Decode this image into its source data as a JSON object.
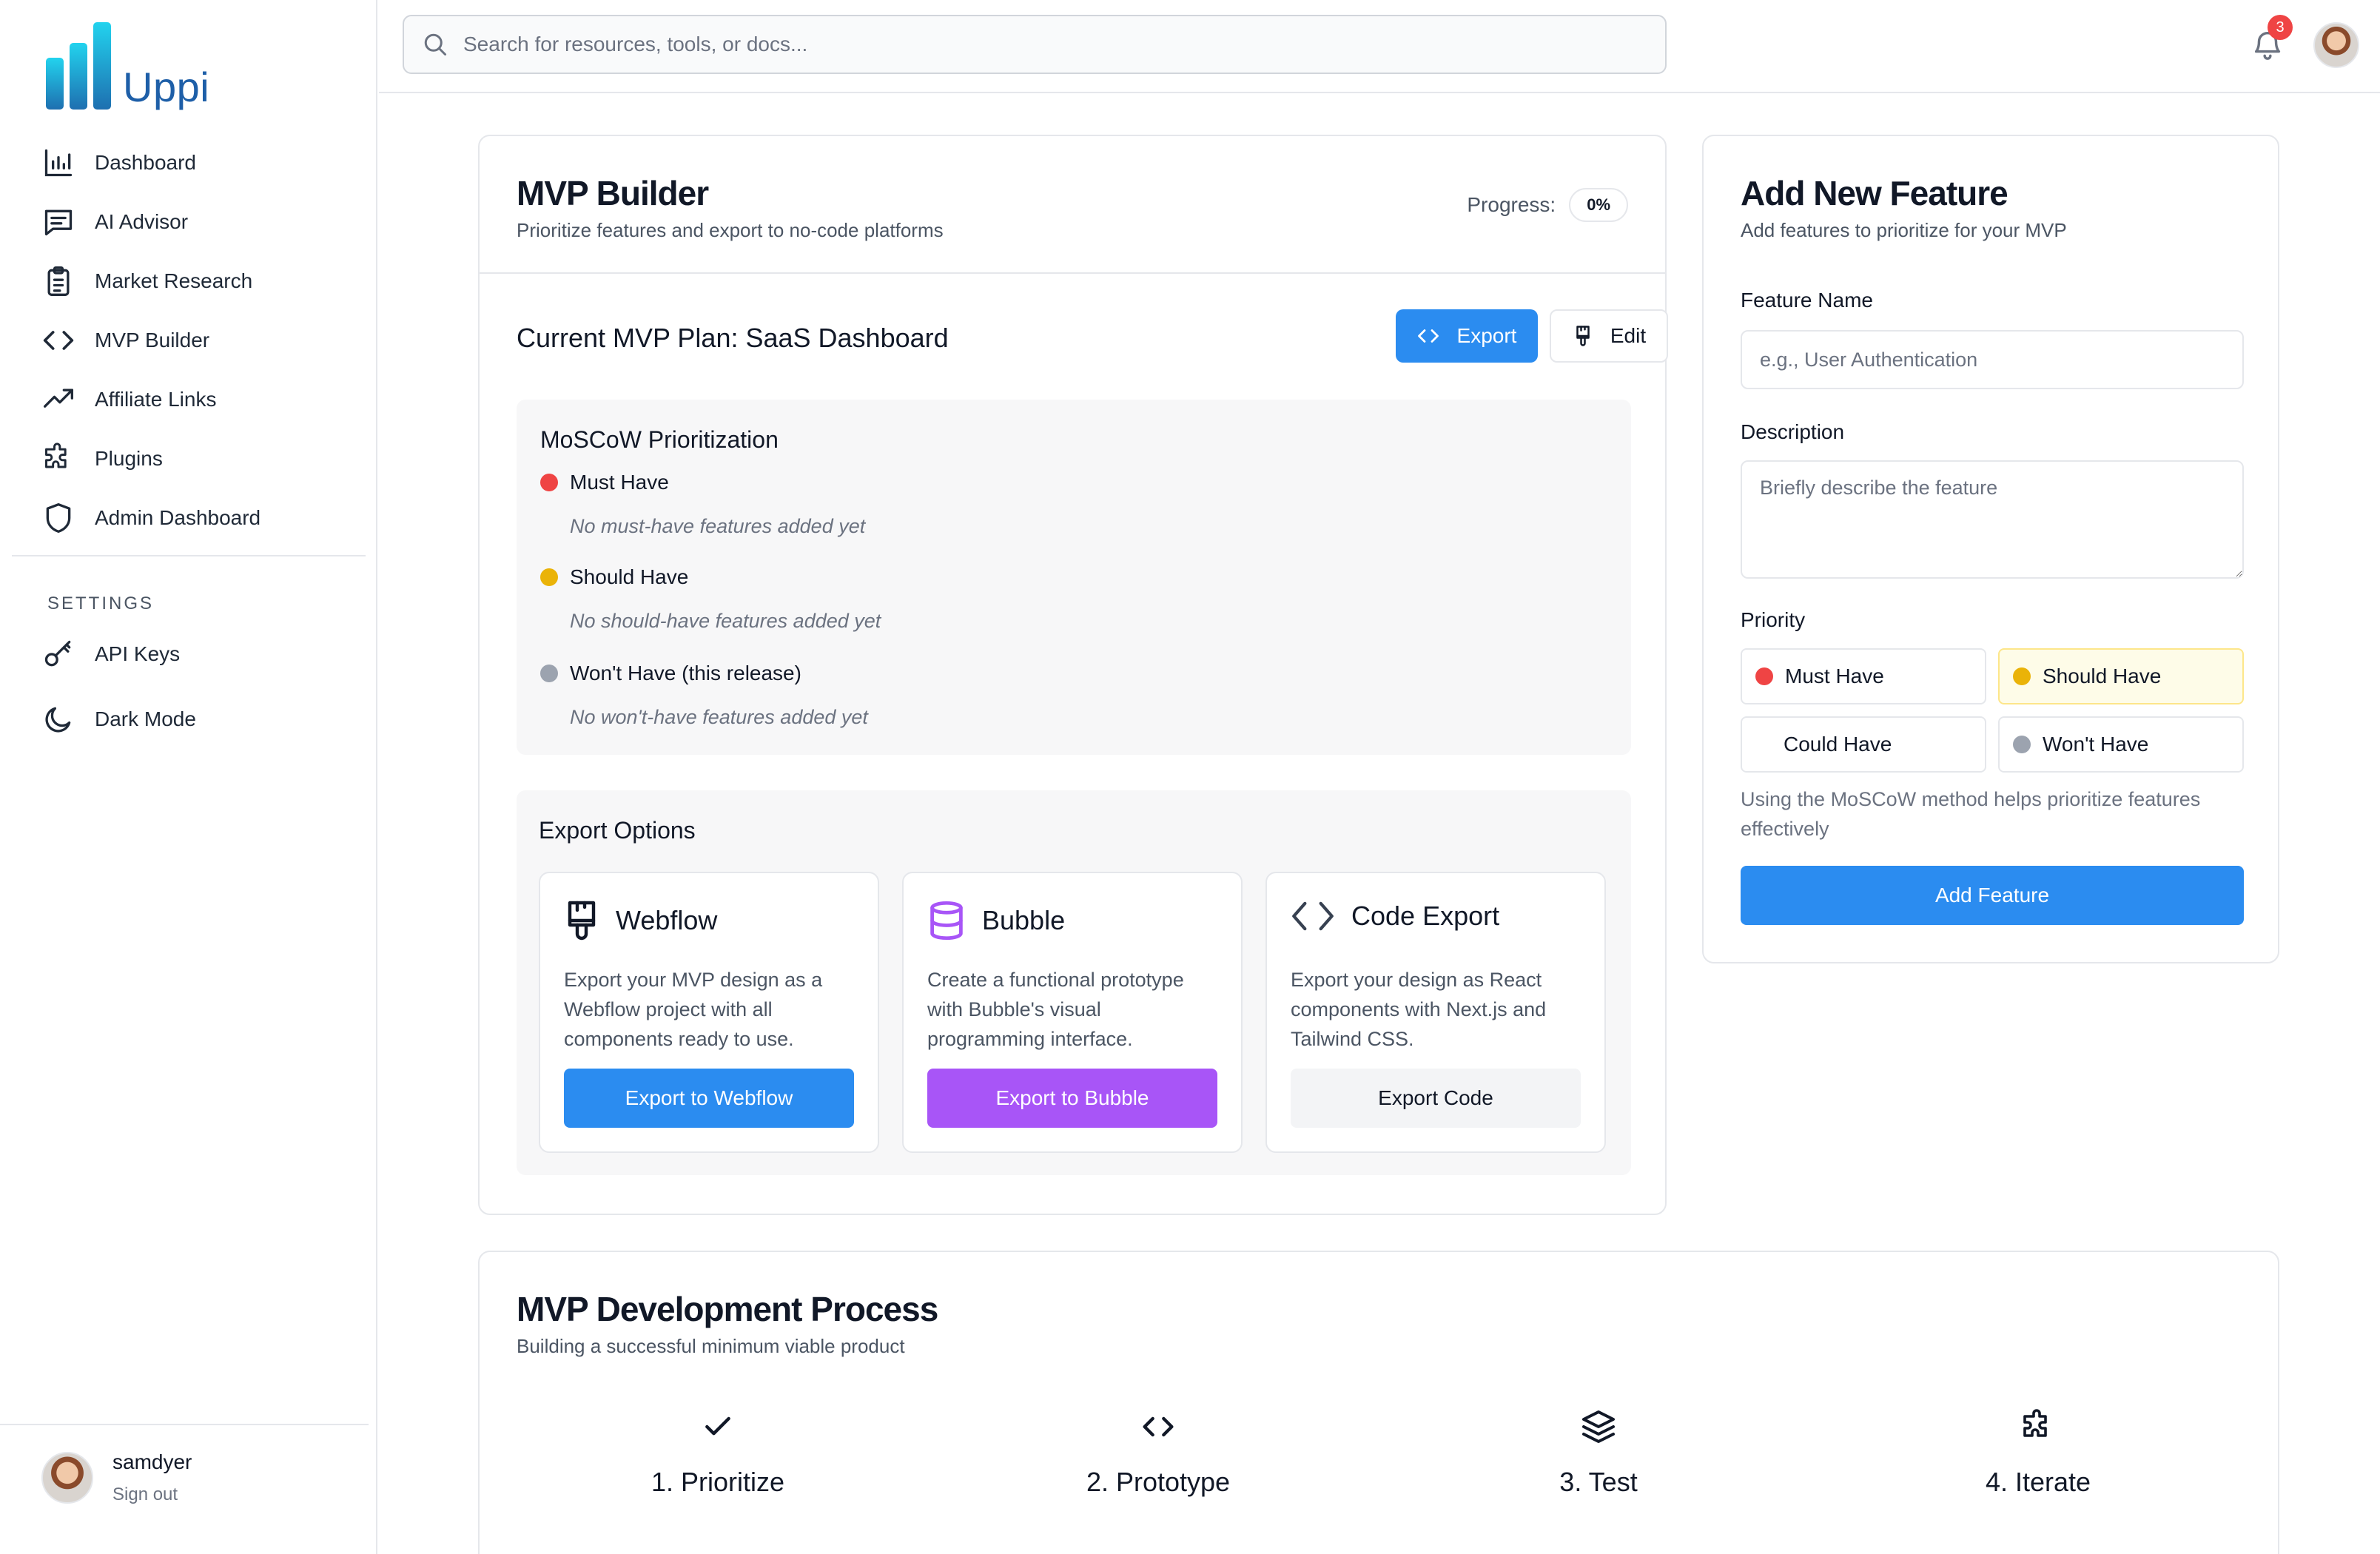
{
  "app": {
    "name": "Uppi"
  },
  "sidebar": {
    "items": [
      {
        "label": "Dashboard",
        "icon": "bar-chart-icon"
      },
      {
        "label": "AI Advisor",
        "icon": "chat-icon"
      },
      {
        "label": "Market Research",
        "icon": "clipboard-icon"
      },
      {
        "label": "MVP Builder",
        "icon": "code-icon"
      },
      {
        "label": "Affiliate Links",
        "icon": "trending-up-icon"
      },
      {
        "label": "Plugins",
        "icon": "puzzle-icon"
      },
      {
        "label": "Admin Dashboard",
        "icon": "shield-icon"
      }
    ],
    "settings_label": "SETTINGS",
    "settings_items": [
      {
        "label": "API Keys",
        "icon": "key-icon"
      },
      {
        "label": "Dark Mode",
        "icon": "moon-icon"
      }
    ],
    "user": {
      "name": "samdyer",
      "signout": "Sign out"
    }
  },
  "topbar": {
    "search_placeholder": "Search for resources, tools, or docs...",
    "notification_count": "3"
  },
  "mvp": {
    "title": "MVP Builder",
    "subtitle": "Prioritize features and export to no-code platforms",
    "progress_label": "Progress:",
    "progress_value": "0%",
    "plan_title": "Current MVP Plan: SaaS Dashboard",
    "export_label": "Export",
    "edit_label": "Edit",
    "moscow": {
      "title": "MoSCoW Prioritization",
      "must": {
        "label": "Must Have",
        "empty": "No must-have features added yet",
        "color": "#ef4444"
      },
      "should": {
        "label": "Should Have",
        "empty": "No should-have features added yet",
        "color": "#eab308"
      },
      "wont": {
        "label": "Won't Have (this release)",
        "empty": "No won't-have features added yet",
        "color": "#9ca3af"
      }
    },
    "export_options": {
      "title": "Export Options",
      "webflow": {
        "name": "Webflow",
        "desc": "Export your MVP design as a Webflow project with all components ready to use.",
        "button": "Export to Webflow",
        "color": "#2b8cf0"
      },
      "bubble": {
        "name": "Bubble",
        "desc": "Create a functional prototype with Bubble's visual programming interface.",
        "button": "Export to Bubble",
        "color": "#a855f7"
      },
      "code": {
        "name": "Code Export",
        "desc": "Export your design as React components with Next.js and Tailwind CSS.",
        "button": "Export Code"
      }
    }
  },
  "feature_form": {
    "title": "Add New Feature",
    "subtitle": "Add features to prioritize for your MVP",
    "name_label": "Feature Name",
    "name_placeholder": "e.g., User Authentication",
    "desc_label": "Description",
    "desc_placeholder": "Briefly describe the feature",
    "priority_label": "Priority",
    "priorities": [
      {
        "label": "Must Have",
        "color": "#ef4444"
      },
      {
        "label": "Should Have",
        "color": "#eab308",
        "selected": true
      },
      {
        "label": "Could Have"
      },
      {
        "label": "Won't Have",
        "color": "#9ca3af"
      }
    ],
    "hint": "Using the MoSCoW method helps prioritize features effectively",
    "submit_label": "Add Feature"
  },
  "process": {
    "title": "MVP Development Process",
    "subtitle": "Building a successful minimum viable product",
    "steps": [
      {
        "label": "1. Prioritize",
        "icon": "check-icon"
      },
      {
        "label": "2. Prototype",
        "icon": "code-icon"
      },
      {
        "label": "3. Test",
        "icon": "layers-icon"
      },
      {
        "label": "4. Iterate",
        "icon": "puzzle-icon"
      }
    ]
  }
}
